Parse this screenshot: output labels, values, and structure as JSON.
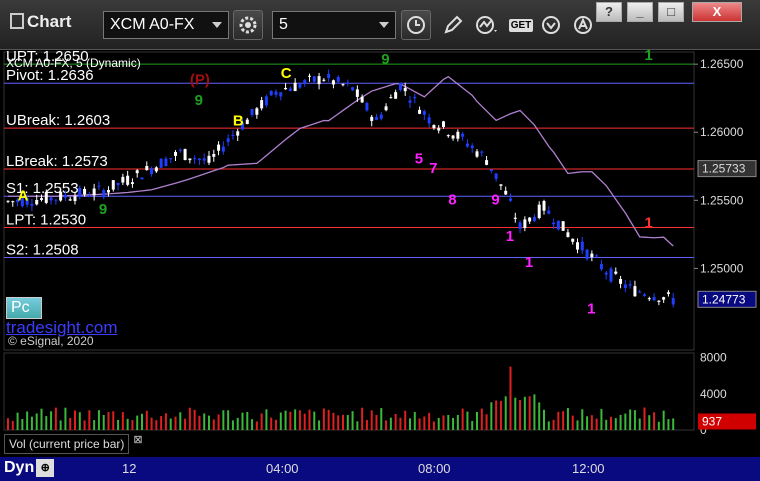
{
  "toolbar": {
    "title": "Chart",
    "symbol": "XCM A0-FX",
    "interval": "5",
    "get_label": "GET",
    "win_help": "?",
    "win_min": "_",
    "win_max": "□",
    "win_close": "X"
  },
  "chart_header": "XCM A0-FX, 5 (Dynamic)",
  "brand": "tradesight.com",
  "copyright": "© eSignal, 2020",
  "pc_label": "Pc",
  "dyn_label": "Dyn",
  "vol_label": "Vol (current price bar)",
  "vol_close": "⊠",
  "colors": {
    "up": "#ffffff",
    "down": "#1f3fff",
    "level": "#ff3030",
    "pivot": "#6060ff",
    "upper": "#1fa01f",
    "ma": "#b080d0",
    "vol_up": "#3cb83c",
    "vol_down": "#e02020"
  },
  "chart_data": {
    "type": "candlestick",
    "title": "XCM A0-FX, 5 (Dynamic)",
    "ylim": [
      1.2443,
      1.2656
    ],
    "y_ticks": [
      "1.26500",
      "1.26000",
      "1.25500",
      "1.25000"
    ],
    "x_ticks": [
      "12",
      "04:00",
      "08:00",
      "12:00"
    ],
    "last_price": "1.24773",
    "ma_value": "1.25733",
    "levels": [
      {
        "label": "UPT: 1.2650",
        "value": 1.265,
        "role": "upt"
      },
      {
        "label": "Pivot: 1.2636",
        "value": 1.2636,
        "role": "pivot"
      },
      {
        "label": "UBreak: 1.2603",
        "value": 1.2603,
        "role": "level"
      },
      {
        "label": "LBreak: 1.2573",
        "value": 1.2573,
        "role": "level"
      },
      {
        "label": "S1: 1.2553",
        "value": 1.2553,
        "role": "pivot"
      },
      {
        "label": "LPT: 1.2530",
        "value": 1.253,
        "role": "level"
      },
      {
        "label": "S2: 1.2508",
        "value": 1.2508,
        "role": "pivot"
      }
    ],
    "annotations": [
      {
        "text": "A",
        "i": 2,
        "y": 1.255,
        "color": "#ffff00"
      },
      {
        "text": "B",
        "i": 47,
        "y": 1.2605,
        "color": "#ffff00"
      },
      {
        "text": "C",
        "i": 57,
        "y": 1.264,
        "color": "#ffff00"
      },
      {
        "text": "(P)",
        "i": 38,
        "y": 1.2635,
        "color": "#a01010"
      },
      {
        "text": "5",
        "i": 85,
        "y": 1.2577,
        "color": "#ff20ff"
      },
      {
        "text": "7",
        "i": 88,
        "y": 1.257,
        "color": "#ff20ff"
      },
      {
        "text": "8",
        "i": 92,
        "y": 1.2547,
        "color": "#ff20ff"
      },
      {
        "text": "9",
        "i": 101,
        "y": 1.2547,
        "color": "#ff20ff"
      },
      {
        "text": "1",
        "i": 104,
        "y": 1.252,
        "color": "#ff20ff"
      },
      {
        "text": "1",
        "i": 108,
        "y": 1.2501,
        "color": "#ff20ff"
      },
      {
        "text": "1",
        "i": 121,
        "y": 1.2467,
        "color": "#ff20ff"
      },
      {
        "text": "1",
        "i": 133,
        "y": 1.2653,
        "color": "#1fa01f"
      },
      {
        "text": "1",
        "i": 133,
        "y": 1.253,
        "color": "#ff3030"
      },
      {
        "text": "9",
        "i": 39,
        "y": 1.262,
        "color": "#1fa01f"
      },
      {
        "text": "9",
        "i": 78,
        "y": 1.265,
        "color": "#1fa01f"
      },
      {
        "text": "9",
        "i": 19,
        "y": 1.254,
        "color": "#1fa01f"
      }
    ],
    "vol_ticks": [
      "8000",
      "4000",
      "0"
    ],
    "vol_last": "937",
    "vol_ylim": [
      0,
      8500
    ]
  }
}
